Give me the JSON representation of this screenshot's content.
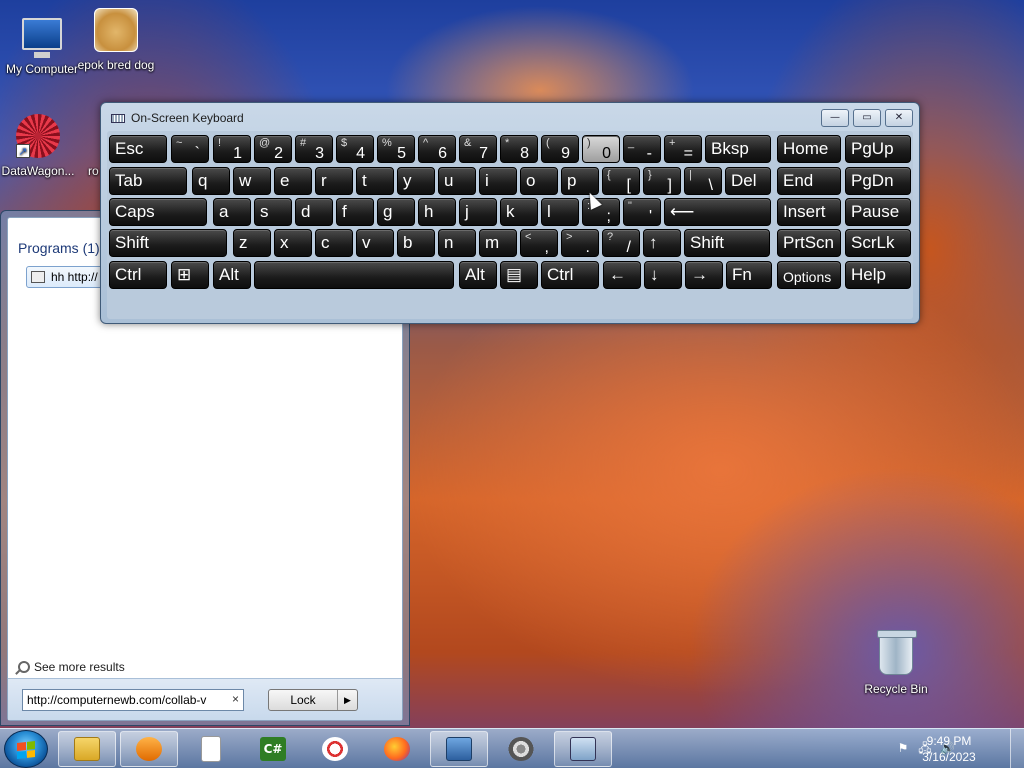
{
  "desktop": {
    "icons": [
      {
        "label": "My Computer",
        "icon": "computer-icon"
      },
      {
        "label": "epok bred dog",
        "icon": "doge-image-icon"
      },
      {
        "label": "DataWagon...",
        "icon": "datawagon-shortcut-icon"
      },
      {
        "label": "ro",
        "icon": "partial-icon"
      },
      {
        "label": "Recycle Bin",
        "icon": "recycle-bin-icon"
      }
    ]
  },
  "start_menu": {
    "programs_title": "Programs (1)",
    "program_item": "hh http://",
    "see_more": "See more results",
    "search_value": "http://computernewb.com/collab-v",
    "clear_glyph": "×",
    "lock_label": "Lock",
    "lock_arrow": "▶"
  },
  "osk": {
    "title": "On-Screen Keyboard",
    "min_glyph": "—",
    "restore_glyph": "▭",
    "close_glyph": "✕",
    "keys": [
      {
        "shift": "",
        "main": "Esc",
        "row": 0
      },
      {
        "shift": "~",
        "main": "`",
        "row": 0
      },
      {
        "shift": "!",
        "main": "1",
        "row": 0
      },
      {
        "shift": "@",
        "main": "2",
        "row": 0
      },
      {
        "shift": "#",
        "main": "3",
        "row": 0
      },
      {
        "shift": "$",
        "main": "4",
        "row": 0
      },
      {
        "shift": "%",
        "main": "5",
        "row": 0
      },
      {
        "shift": "^",
        "main": "6",
        "row": 0
      },
      {
        "shift": "&",
        "main": "7",
        "row": 0
      },
      {
        "shift": "*",
        "main": "8",
        "row": 0
      },
      {
        "shift": "(",
        "main": "9",
        "row": 0
      },
      {
        "shift": ")",
        "main": "0",
        "row": 0,
        "active": true
      },
      {
        "shift": "_",
        "main": "-",
        "row": 0
      },
      {
        "shift": "+",
        "main": "=",
        "row": 0
      },
      {
        "shift": "",
        "main": "Bksp",
        "row": 0
      },
      {
        "shift": "",
        "main": "Home",
        "row": 0
      },
      {
        "shift": "",
        "main": "PgUp",
        "row": 0
      },
      {
        "shift": "",
        "main": "Tab",
        "row": 1
      },
      {
        "shift": "",
        "main": "q",
        "row": 1
      },
      {
        "shift": "",
        "main": "w",
        "row": 1
      },
      {
        "shift": "",
        "main": "e",
        "row": 1
      },
      {
        "shift": "",
        "main": "r",
        "row": 1
      },
      {
        "shift": "",
        "main": "t",
        "row": 1
      },
      {
        "shift": "",
        "main": "y",
        "row": 1
      },
      {
        "shift": "",
        "main": "u",
        "row": 1
      },
      {
        "shift": "",
        "main": "i",
        "row": 1
      },
      {
        "shift": "",
        "main": "o",
        "row": 1
      },
      {
        "shift": "",
        "main": "p",
        "row": 1
      },
      {
        "shift": "{",
        "main": "[",
        "row": 1
      },
      {
        "shift": "}",
        "main": "]",
        "row": 1
      },
      {
        "shift": "|",
        "main": "\\",
        "row": 1
      },
      {
        "shift": "",
        "main": "Del",
        "row": 1
      },
      {
        "shift": "",
        "main": "End",
        "row": 1
      },
      {
        "shift": "",
        "main": "PgDn",
        "row": 1
      },
      {
        "shift": "",
        "main": "Caps",
        "row": 2
      },
      {
        "shift": "",
        "main": "a",
        "row": 2
      },
      {
        "shift": "",
        "main": "s",
        "row": 2
      },
      {
        "shift": "",
        "main": "d",
        "row": 2
      },
      {
        "shift": "",
        "main": "f",
        "row": 2
      },
      {
        "shift": "",
        "main": "g",
        "row": 2
      },
      {
        "shift": "",
        "main": "h",
        "row": 2
      },
      {
        "shift": "",
        "main": "j",
        "row": 2
      },
      {
        "shift": "",
        "main": "k",
        "row": 2
      },
      {
        "shift": "",
        "main": "l",
        "row": 2
      },
      {
        "shift": ":",
        "main": ";",
        "row": 2
      },
      {
        "shift": "\"",
        "main": "'",
        "row": 2
      },
      {
        "shift": "",
        "main": "⟵",
        "row": 2
      },
      {
        "shift": "",
        "main": "Insert",
        "row": 2
      },
      {
        "shift": "",
        "main": "Pause",
        "row": 2
      },
      {
        "shift": "",
        "main": "Shift",
        "row": 3
      },
      {
        "shift": "",
        "main": "z",
        "row": 3
      },
      {
        "shift": "",
        "main": "x",
        "row": 3
      },
      {
        "shift": "",
        "main": "c",
        "row": 3
      },
      {
        "shift": "",
        "main": "v",
        "row": 3
      },
      {
        "shift": "",
        "main": "b",
        "row": 3
      },
      {
        "shift": "",
        "main": "n",
        "row": 3
      },
      {
        "shift": "",
        "main": "m",
        "row": 3
      },
      {
        "shift": "<",
        "main": ",",
        "row": 3
      },
      {
        "shift": ">",
        "main": ".",
        "row": 3
      },
      {
        "shift": "?",
        "main": "/",
        "row": 3
      },
      {
        "shift": "",
        "main": "↑",
        "row": 3
      },
      {
        "shift": "",
        "main": "Shift",
        "row": 3
      },
      {
        "shift": "",
        "main": "PrtScn",
        "row": 3
      },
      {
        "shift": "",
        "main": "ScrLk",
        "row": 3
      },
      {
        "shift": "",
        "main": "Ctrl",
        "row": 4
      },
      {
        "shift": "",
        "main": "⊞",
        "row": 4
      },
      {
        "shift": "",
        "main": "Alt",
        "row": 4
      },
      {
        "shift": "",
        "main": "",
        "row": 4
      },
      {
        "shift": "",
        "main": "Alt",
        "row": 4
      },
      {
        "shift": "",
        "main": "▤",
        "row": 4
      },
      {
        "shift": "",
        "main": "Ctrl",
        "row": 4
      },
      {
        "shift": "",
        "main": "←",
        "row": 4
      },
      {
        "shift": "",
        "main": "↓",
        "row": 4
      },
      {
        "shift": "",
        "main": "→",
        "row": 4
      },
      {
        "shift": "",
        "main": "Fn",
        "row": 4
      },
      {
        "shift": "",
        "main": "Options",
        "row": 4
      },
      {
        "shift": "",
        "main": "Help",
        "row": 4
      }
    ]
  },
  "taskbar": {
    "items": [
      {
        "name": "explorer",
        "icon": "folder-icon",
        "open": true
      },
      {
        "name": "media-player",
        "icon": "media-player-icon",
        "open": true
      },
      {
        "name": "notepad",
        "icon": "document-icon",
        "open": false
      },
      {
        "name": "csharp",
        "icon": "csharp-icon",
        "open": false,
        "text": "C#"
      },
      {
        "name": "paint",
        "icon": "paint-icon",
        "open": false
      },
      {
        "name": "firefox",
        "icon": "firefox-icon",
        "open": false
      },
      {
        "name": "control-panel",
        "icon": "control-panel-icon",
        "open": true
      },
      {
        "name": "settings",
        "icon": "gear-icon",
        "open": false
      },
      {
        "name": "on-screen-keyboard",
        "icon": "keyboard-icon",
        "open": true
      }
    ],
    "tray_glyphs": [
      "⚑",
      "🖧",
      "🔊"
    ],
    "time": "9:49 PM",
    "date": "3/16/2023"
  }
}
